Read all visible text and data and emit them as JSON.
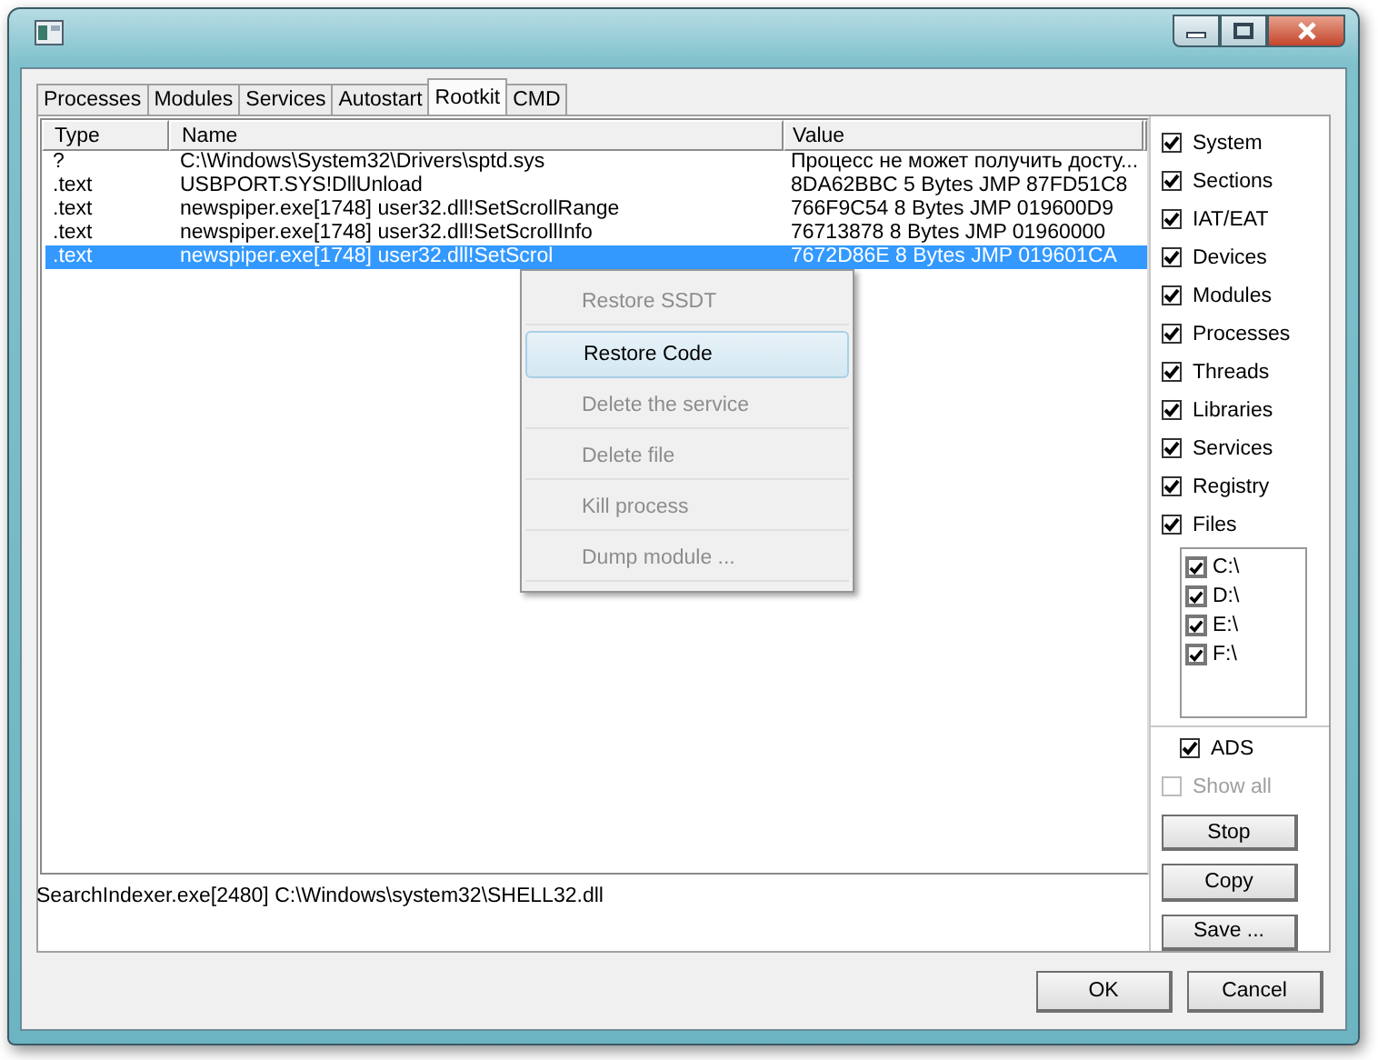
{
  "tabs": [
    {
      "label": "Processes",
      "selected": false
    },
    {
      "label": "Modules",
      "selected": false
    },
    {
      "label": "Services",
      "selected": false
    },
    {
      "label": "Autostart",
      "selected": false
    },
    {
      "label": "Rootkit",
      "selected": true
    },
    {
      "label": "CMD",
      "selected": false
    }
  ],
  "table": {
    "columns": [
      "Type",
      "Name",
      "Value"
    ],
    "rows": [
      {
        "type": "?",
        "name": "C:\\Windows\\System32\\Drivers\\sptd.sys",
        "value": "Процесс не может получить досту...",
        "selected": false
      },
      {
        "type": ".text",
        "name": "USBPORT.SYS!DllUnload",
        "value": "8DA62BBC 5 Bytes  JMP 87FD51C8",
        "selected": false
      },
      {
        "type": ".text",
        "name": "newspiper.exe[1748] user32.dll!SetScrollRange",
        "value": "766F9C54 8 Bytes  JMP 019600D9",
        "selected": false
      },
      {
        "type": ".text",
        "name": "newspiper.exe[1748] user32.dll!SetScrollInfo",
        "value": "76713878 8 Bytes  JMP 01960000",
        "selected": false
      },
      {
        "type": ".text",
        "name": "newspiper.exe[1748] user32.dll!SetScrol",
        "value": "7672D86E 8 Bytes  JMP 019601CA",
        "selected": true
      }
    ]
  },
  "context_menu": [
    {
      "label": "Restore SSDT",
      "disabled": true,
      "selected": false
    },
    {
      "label": "Restore Code",
      "disabled": false,
      "selected": true
    },
    {
      "label": "Delete the service",
      "disabled": true,
      "selected": false
    },
    {
      "label": "Delete file",
      "disabled": true,
      "selected": false
    },
    {
      "label": "Kill process",
      "disabled": true,
      "selected": false
    },
    {
      "label": "Dump module ...",
      "disabled": true,
      "selected": false
    }
  ],
  "status_text": "SearchIndexer.exe[2480] C:\\Windows\\system32\\SHELL32.dll",
  "scan_options": [
    {
      "label": "System",
      "checked": true
    },
    {
      "label": "Sections",
      "checked": true
    },
    {
      "label": "IAT/EAT",
      "checked": true
    },
    {
      "label": "Devices",
      "checked": true
    },
    {
      "label": "Modules",
      "checked": true
    },
    {
      "label": "Processes",
      "checked": true
    },
    {
      "label": "Threads",
      "checked": true
    },
    {
      "label": "Libraries",
      "checked": true
    },
    {
      "label": "Services",
      "checked": true
    },
    {
      "label": "Registry",
      "checked": true
    },
    {
      "label": "Files",
      "checked": true
    }
  ],
  "drives": [
    {
      "label": "C:\\",
      "checked": true
    },
    {
      "label": "D:\\",
      "checked": true
    },
    {
      "label": "E:\\",
      "checked": true
    },
    {
      "label": "F:\\",
      "checked": true
    }
  ],
  "ads": {
    "label": "ADS",
    "checked": true,
    "disabled": false
  },
  "show_all": {
    "label": "Show all",
    "checked": false,
    "disabled": true
  },
  "side_buttons": [
    "Stop",
    "Copy",
    "Save ..."
  ],
  "dialog_buttons": [
    "OK",
    "Cancel"
  ]
}
